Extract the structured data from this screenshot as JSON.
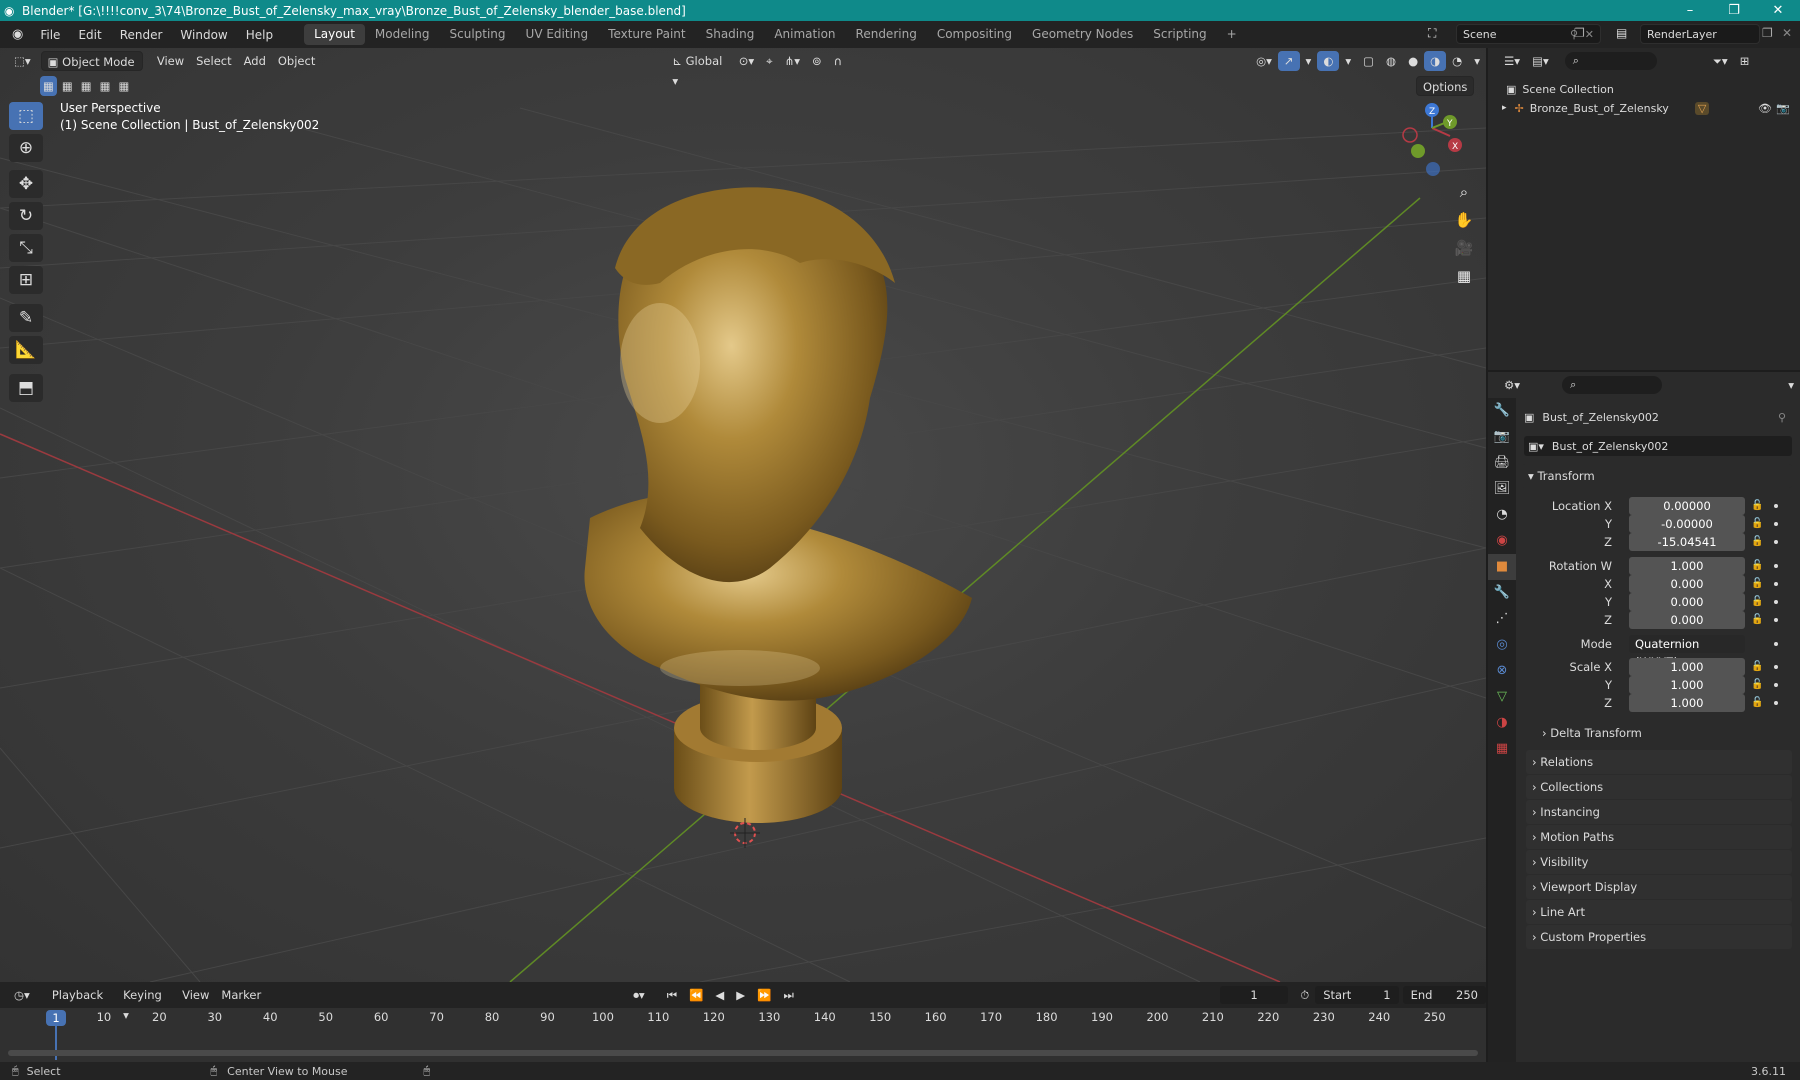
{
  "window": {
    "title": "Blender* [G:\\!!!!conv_3\\74\\Bronze_Bust_of_Zelensky_max_vray\\Bronze_Bust_of_Zelensky_blender_base.blend]",
    "controls": [
      "–",
      "❐",
      "✕"
    ]
  },
  "menu": {
    "items": [
      "File",
      "Edit",
      "Render",
      "Window",
      "Help"
    ],
    "workspaces": [
      "Layout",
      "Modeling",
      "Sculpting",
      "UV Editing",
      "Texture Paint",
      "Shading",
      "Animation",
      "Rendering",
      "Compositing",
      "Geometry Nodes",
      "Scripting"
    ],
    "active_workspace": "Layout",
    "add_workspace": "+",
    "scene": "Scene",
    "view_layer": "RenderLayer"
  },
  "viewport": {
    "mode": "Object Mode",
    "menus": [
      "View",
      "Select",
      "Add",
      "Object"
    ],
    "orientation": "Global",
    "options_label": "Options",
    "overlay_line1": "User Perspective",
    "overlay_line2": "(1) Scene Collection | Bust_of_Zelensky002",
    "gizmo_axes": [
      "X",
      "Y",
      "Z"
    ],
    "colors": {
      "bronze": "#b08a3a",
      "x_axis": "#b63a45",
      "y_axis": "#6f9a2a",
      "z_axis": "#3d78d6",
      "accent": "#4772b3"
    }
  },
  "tools": [
    "select-box",
    "cursor",
    "move",
    "rotate",
    "scale",
    "transform",
    "annotate",
    "measure",
    "add-cube"
  ],
  "outliner": {
    "root": "Scene Collection",
    "items": [
      {
        "label": "Bronze_Bust_of_Zelensky",
        "icon": "empty-icon"
      }
    ]
  },
  "properties": {
    "object_name": "Bust_of_Zelensky002",
    "object_field": "Bust_of_Zelensky002",
    "transform_label": "Transform",
    "location": {
      "label": "Location X",
      "x": "0.00000",
      "y": "-0.00000",
      "z": "-15.04541"
    },
    "rotation": {
      "label": "Rotation W",
      "w": "1.000",
      "x": "0.000",
      "y": "0.000",
      "z": "0.000"
    },
    "mode_label": "Mode",
    "mode_value": "Quaternion (WXYZ)",
    "scale": {
      "label": "Scale X",
      "x": "1.000",
      "y": "1.000",
      "z": "1.000"
    },
    "axis_labels": {
      "y": "Y",
      "z": "Z",
      "x": "X"
    },
    "delta_transform": "Delta Transform",
    "panels": [
      "Relations",
      "Collections",
      "Instancing",
      "Motion Paths",
      "Visibility",
      "Viewport Display",
      "Line Art",
      "Custom Properties"
    ]
  },
  "timeline": {
    "menus": [
      "Playback",
      "Keying",
      "View",
      "Marker"
    ],
    "current_frame": "1",
    "start_label": "Start",
    "start": "1",
    "end_label": "End",
    "end": "250",
    "ruler": [
      "1",
      "10",
      "20",
      "30",
      "40",
      "50",
      "60",
      "70",
      "80",
      "90",
      "100",
      "110",
      "120",
      "130",
      "140",
      "150",
      "160",
      "170",
      "180",
      "190",
      "200",
      "210",
      "220",
      "230",
      "240",
      "250"
    ]
  },
  "status": {
    "select": "Select",
    "center_view": "Center View to Mouse",
    "version": "3.6.11"
  }
}
